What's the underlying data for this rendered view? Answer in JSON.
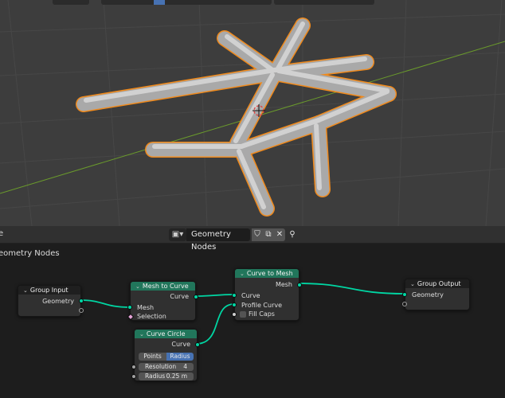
{
  "node_editor": {
    "header": {
      "left_text": "e",
      "tree_type_icon": "geometry-nodes-icon",
      "tree_name": "Geometry Nodes",
      "buttons": [
        "shield-icon",
        "copy-icon",
        "close-icon",
        "pin-icon"
      ]
    },
    "breadcrumb": "eometry Nodes",
    "nodes": {
      "group_input": {
        "title": "Group Input",
        "outputs": [
          "Geometry"
        ]
      },
      "mesh_to_curve": {
        "title": "Mesh to Curve",
        "output": "Curve",
        "inputs": [
          "Mesh",
          "Selection"
        ]
      },
      "curve_circle": {
        "title": "Curve Circle",
        "output": "Curve",
        "mode_options": [
          "Points",
          "Radius"
        ],
        "mode_selected": "Radius",
        "resolution_label": "Resolution",
        "resolution_value": "4",
        "radius_label": "Radius",
        "radius_value": "0.25 m"
      },
      "curve_to_mesh": {
        "title": "Curve to Mesh",
        "output": "Mesh",
        "inputs": [
          "Curve",
          "Profile Curve",
          "Fill Caps"
        ]
      },
      "group_output": {
        "title": "Group Output",
        "inputs": [
          "Geometry"
        ]
      }
    }
  },
  "colors": {
    "geometry_socket": "#00d6a3",
    "node_header_geometry": "#21765b",
    "selection_outline": "#f08a1c",
    "viewport_bg": "#3d3d3d",
    "x_axis": "#a03c3c",
    "y_axis": "#6a9a2c"
  }
}
